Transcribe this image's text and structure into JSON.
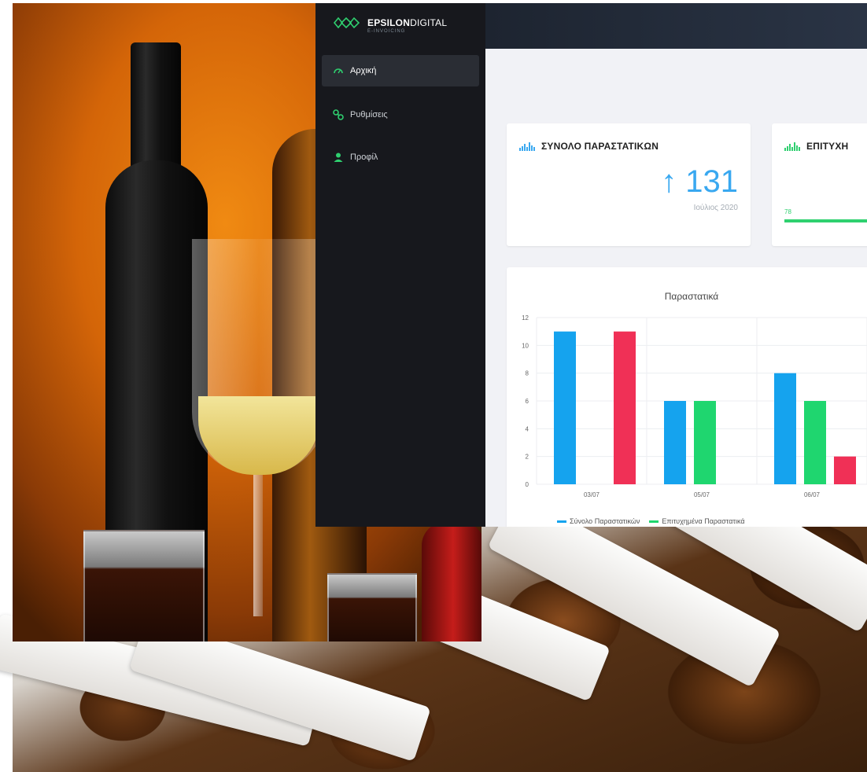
{
  "app": {
    "brand_bold": "EPSILON",
    "brand_light": "DIGITAL",
    "brand_sub": "E-INVOICING"
  },
  "sidebar": {
    "items": [
      {
        "label": "Αρχική",
        "icon": "dashboard-icon",
        "active": true
      },
      {
        "label": "Ρυθμίσεις",
        "icon": "settings-nodes-icon",
        "active": false
      },
      {
        "label": "Προφίλ",
        "icon": "user-icon",
        "active": false
      }
    ]
  },
  "cards": {
    "total": {
      "title": "ΣΥΝΟΛΟ ΠΑΡΑΣΤΑΤΙΚΩΝ",
      "value": "131",
      "arrow": "↑",
      "date": "Ιούλιος 2020"
    },
    "success": {
      "title": "ΕΠΙΤΥΧΗ",
      "progress_label": "78",
      "progress_percent": 100
    }
  },
  "colors": {
    "blue": "#15a3ee",
    "green": "#1fd66f",
    "red": "#f03056",
    "accent": "#2fcf6f"
  },
  "chart_data": {
    "type": "bar",
    "title": "Παραστατικά",
    "categories": [
      "03/07",
      "05/07",
      "06/07"
    ],
    "yticks": [
      0,
      2,
      4,
      6,
      8,
      10,
      12
    ],
    "ylim": [
      0,
      12
    ],
    "grid": true,
    "legend_position": "bottom",
    "series": [
      {
        "name": "Σύνολο Παραστατικών",
        "color": "#15a3ee",
        "values": [
          11,
          6,
          8
        ]
      },
      {
        "name": "Επιτυχημένα Παραστατικά",
        "color": "#1fd66f",
        "values": [
          0,
          6,
          6
        ]
      },
      {
        "name": "",
        "color": "#f03056",
        "values": [
          11,
          0,
          2
        ]
      }
    ],
    "legend": [
      "Σύνολο Παραστατικών",
      "Επιτυχημένα Παραστατικά"
    ]
  }
}
